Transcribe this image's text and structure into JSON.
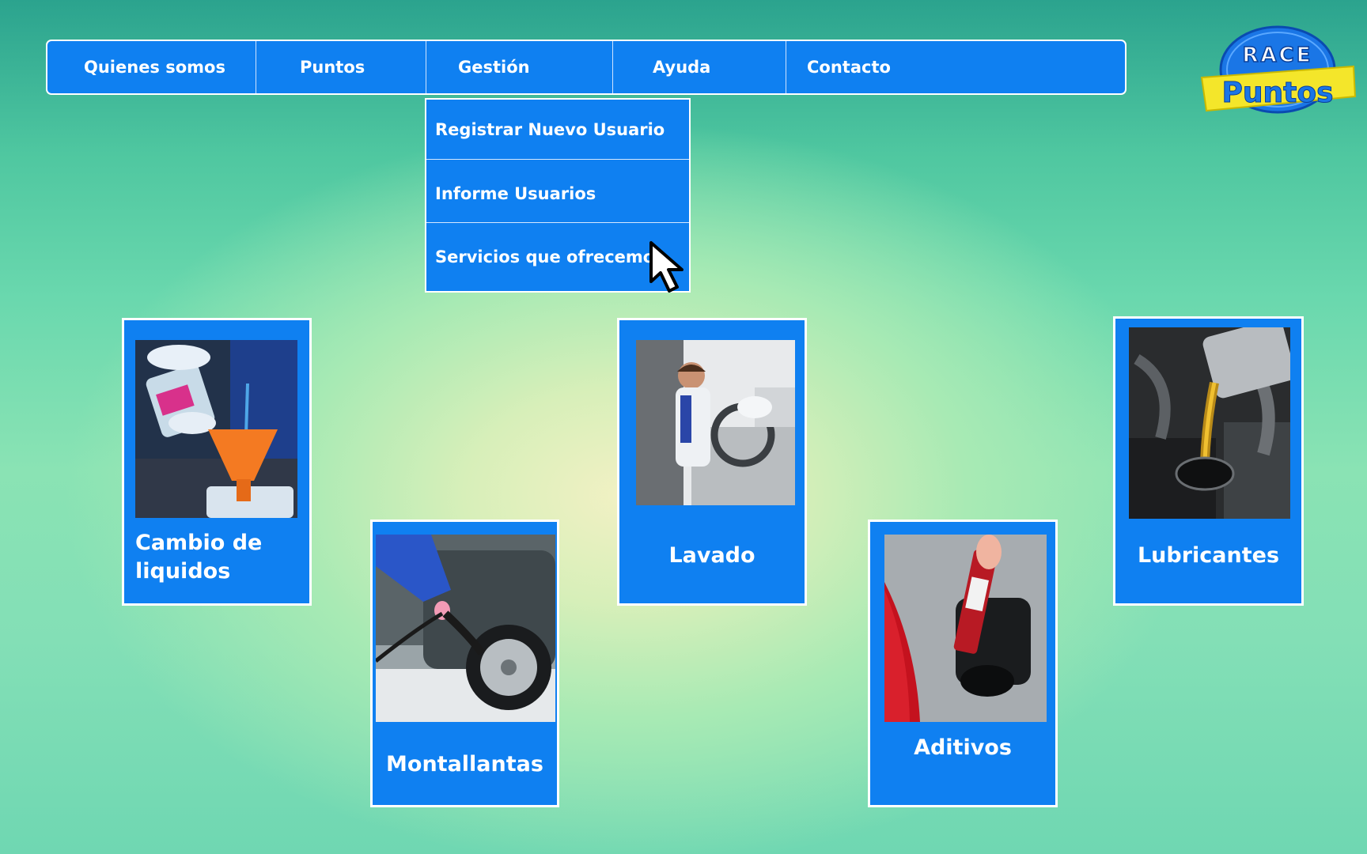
{
  "nav": {
    "items": [
      "Quienes  somos",
      "Puntos",
      "Gestión",
      "Ayuda",
      "Contacto"
    ]
  },
  "dropdown": {
    "items": [
      "Registrar Nuevo Usuario",
      "Informe Usuarios",
      "Servicios que ofrecemos"
    ]
  },
  "logo": {
    "line1": "RACE",
    "line2": "Puntos"
  },
  "services": {
    "cambio": {
      "label_line1": "Cambio de",
      "label_line2": "liquidos"
    },
    "montallantas": {
      "label": "Montallantas"
    },
    "lavado": {
      "label": "Lavado"
    },
    "aditivos": {
      "label": "Aditivos"
    },
    "lubricantes": {
      "label": "Lubricantes"
    }
  },
  "colors": {
    "accent_blue": "#0f80f1",
    "logo_yellow": "#f4e62a",
    "background_center": "#f2f1c4",
    "background_edge": "#2ba38e"
  }
}
